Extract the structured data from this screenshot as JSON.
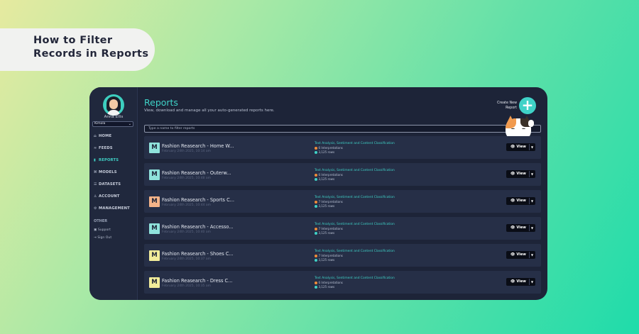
{
  "banner": {
    "line1": "How to Filter",
    "line2": "Records in Reports"
  },
  "sidebar": {
    "user_name": "Anna Ellis",
    "org": "Kimola",
    "nav": [
      {
        "label": "HOME",
        "icon": "home-icon",
        "glyph": "⌂"
      },
      {
        "label": "FEEDS",
        "icon": "feeds-icon",
        "glyph": "≈"
      },
      {
        "label": "REPORTS",
        "icon": "reports-icon",
        "glyph": "▮"
      },
      {
        "label": "MODELS",
        "icon": "models-icon",
        "glyph": "⌘"
      },
      {
        "label": "DATASETS",
        "icon": "datasets-icon",
        "glyph": "☰"
      },
      {
        "label": "ACCOUNT",
        "icon": "account-icon",
        "glyph": "♙"
      },
      {
        "label": "MANAGEMENT",
        "icon": "management-icon",
        "glyph": "⚙"
      }
    ],
    "other_label": "OTHER",
    "support": "Support",
    "sign_out": "Sign Out"
  },
  "header": {
    "title": "Reports",
    "subtitle": "View, download and manage all your auto-generated reports here.",
    "create_label_1": "Create New",
    "create_label_2": "Report",
    "create_glyph": "+"
  },
  "filter": {
    "placeholder": "Type a name to filter reports"
  },
  "colors": {
    "accent": "#3fd2c7",
    "logo_teal": "#8fe3dc",
    "logo_peach": "#f5b489",
    "logo_yellow": "#f1ec9a",
    "interp_dot": "#f08c3a"
  },
  "reports": [
    {
      "logo": "M",
      "logo_color": "#8fe3dc",
      "title": "Fashion Reasearch - Home W...",
      "date": "February 24th 2025, 10:14 am",
      "tags": "Text Analysis, Sentiment and Content Classification",
      "interpretations": "6 Interpretations",
      "rows": "3,125 rows",
      "view": "View"
    },
    {
      "logo": "M",
      "logo_color": "#8fe3dc",
      "title": "Fashion Reasearch - Outerw...",
      "date": "February 24th 2025, 10:48 am",
      "tags": "Text Analysis, Sentiment and Content Classification",
      "interpretations": "6 Interpretations",
      "rows": "3,125 rows",
      "view": "View"
    },
    {
      "logo": "M",
      "logo_color": "#f5b489",
      "title": "Fashion Reasearch - Sports C...",
      "date": "February 24th 2025, 10:44 am",
      "tags": "Text Analysis, Sentiment and Content Classification",
      "interpretations": "7 Interpretations",
      "rows": "3,125 rows",
      "view": "View"
    },
    {
      "logo": "M",
      "logo_color": "#8fe3dc",
      "title": "Fashion Reasearch - Accesso...",
      "date": "February 24th 2025, 10:40 am",
      "tags": "Text Analysis, Sentiment and Content Classification",
      "interpretations": "7 Interpretations",
      "rows": "3,125 rows",
      "view": "View"
    },
    {
      "logo": "M",
      "logo_color": "#f1ec9a",
      "title": "Fashion Reasearch - Shoes C...",
      "date": "February 24th 2025, 10:37 am",
      "tags": "Text Analysis, Sentiment and Content Classification",
      "interpretations": "7 Interpretations",
      "rows": "3,125 rows",
      "view": "View"
    },
    {
      "logo": "M",
      "logo_color": "#f1ec9a",
      "title": "Fashion Reasearch - Dress C...",
      "date": "February 24th 2025, 10:35 am",
      "tags": "Text Analysis, Sentiment and Content Classification",
      "interpretations": "6 Interpretations",
      "rows": "3,125 rows",
      "view": "View"
    }
  ]
}
